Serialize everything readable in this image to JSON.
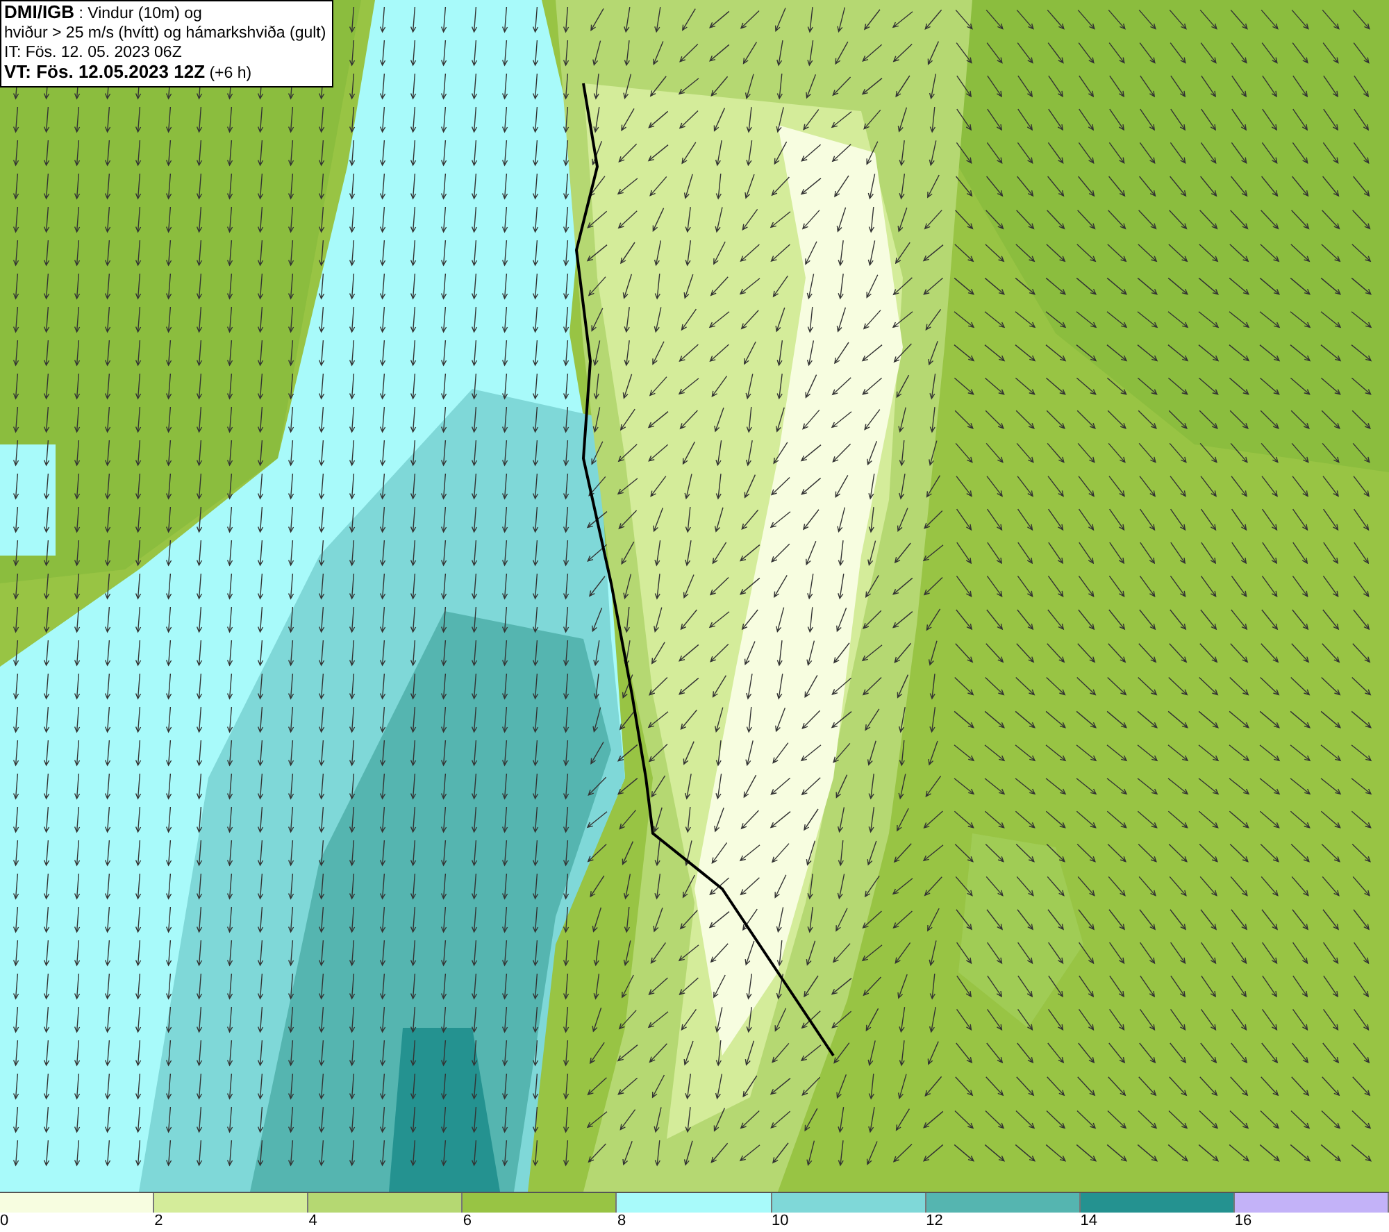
{
  "title_box": {
    "lines": [
      "**DMI/IGB** : Vindur (10m) og",
      "hviður > 25 m/s (hvítt) og hámarkshviða (gult)",
      "IT: Fös. 12. 05. 2023 06Z",
      "**VT: Fös. 12.05.2023 12Z** (+6 h)"
    ]
  },
  "legend": {
    "segments": [
      {
        "label": "0",
        "color": "#f7fde0"
      },
      {
        "label": "2",
        "color": "#d4ec9a"
      },
      {
        "label": "4",
        "color": "#b5d872"
      },
      {
        "label": "6",
        "color": "#98c444"
      },
      {
        "label": "8",
        "color": "#a8fafa"
      },
      {
        "label": "10",
        "color": "#7fd8d8"
      },
      {
        "label": "12",
        "color": "#55b5b0"
      },
      {
        "label": "14",
        "color": "#249290"
      },
      {
        "label": "16",
        "color": "#c3b2f8"
      }
    ]
  }
}
